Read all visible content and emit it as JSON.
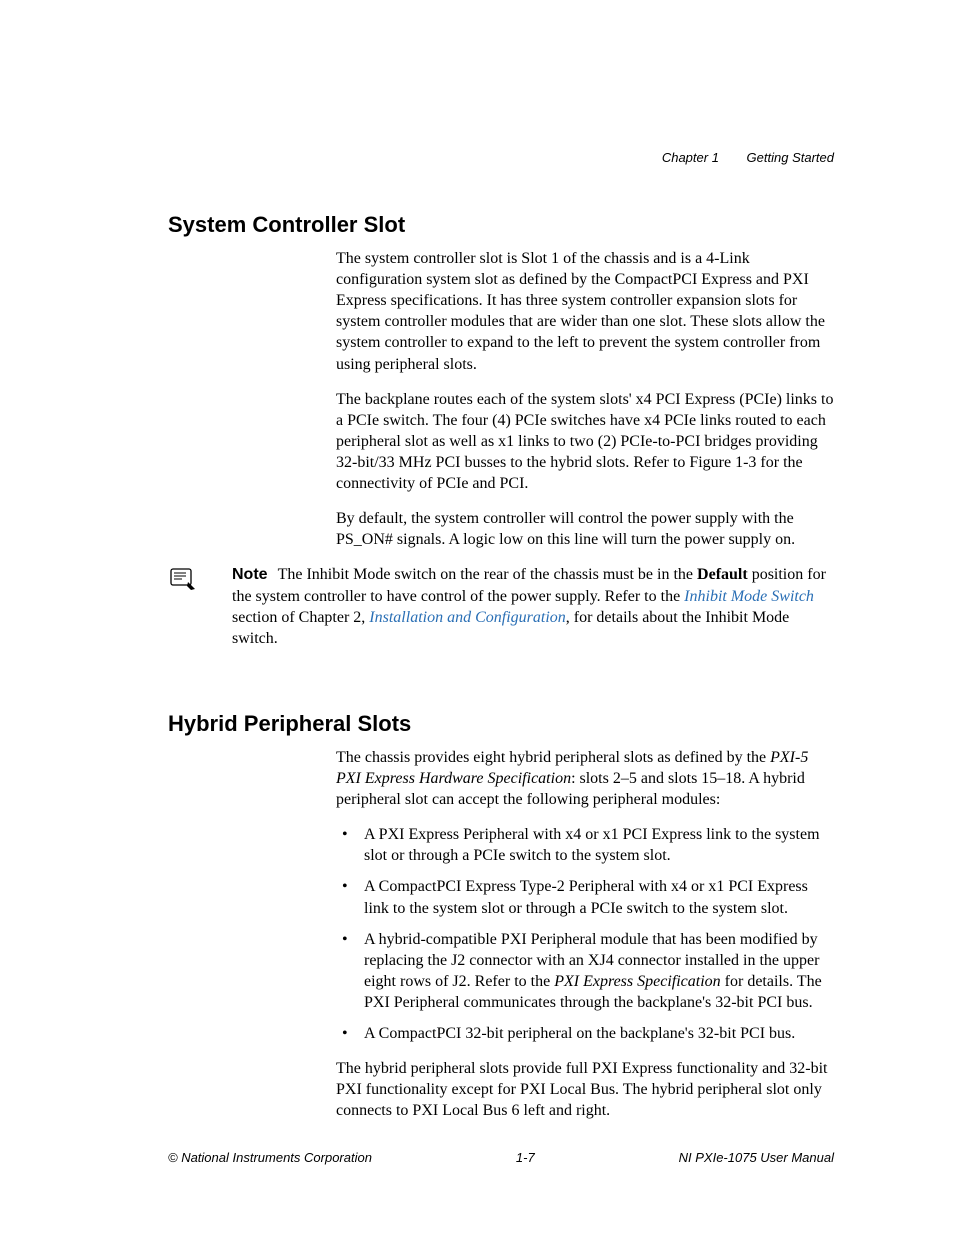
{
  "header": {
    "chapter": "Chapter 1",
    "title": "Getting Started"
  },
  "sections": {
    "system_controller": {
      "heading": "System Controller Slot",
      "p1": "The system controller slot is Slot 1 of the chassis and is a 4-Link configuration system slot as defined by the CompactPCI Express and PXI Express specifications. It has three system controller expansion slots for system controller modules that are wider than one slot. These slots allow the system controller to expand to the left to prevent the system controller from using peripheral slots.",
      "p2": "The backplane routes each of the system slots' x4 PCI Express (PCIe) links to a PCIe switch. The four (4) PCIe switches have x4 PCIe links routed to each peripheral slot as well as x1 links to two (2) PCIe-to-PCI bridges providing 32-bit/33 MHz PCI busses to the hybrid slots. Refer to Figure 1-3 for the connectivity of PCIe and PCI.",
      "p3": "By default, the system controller will control the power supply with the PS_ON# signals. A logic low on this line will turn the power supply on."
    },
    "note": {
      "label": "Note",
      "pre": "The Inhibit Mode switch on the rear of the chassis must be in the ",
      "bold1": "Default",
      "mid1": " position for the system controller to have control of the power supply. Refer to the ",
      "link1": "Inhibit Mode Switch",
      "mid2": " section of Chapter 2, ",
      "link2": "Installation and Configuration",
      "post": ", for details about the Inhibit Mode switch."
    },
    "hybrid": {
      "heading": "Hybrid Peripheral Slots",
      "intro_pre": "The chassis provides eight hybrid peripheral slots as defined by the ",
      "intro_ital": "PXI-5 PXI Express Hardware Specification",
      "intro_post": ": slots 2–5 and slots 15–18. A hybrid peripheral slot can accept the following peripheral modules:",
      "bullets": [
        "A PXI Express Peripheral with x4 or x1 PCI Express link to the system slot or through a PCIe switch to the system slot.",
        "A CompactPCI Express Type-2 Peripheral with x4 or x1 PCI Express link to the system slot or through a PCIe switch to the system slot."
      ],
      "bullet3_pre": "A hybrid-compatible PXI Peripheral module that has been modified by replacing the J2 connector with an XJ4 connector installed in the upper eight rows of J2. Refer to the ",
      "bullet3_ital": "PXI Express Specification",
      "bullet3_post": " for details. The PXI Peripheral communicates through the backplane's 32-bit PCI bus.",
      "bullet4": "A CompactPCI 32-bit peripheral on the backplane's 32-bit PCI bus.",
      "closing": "The hybrid peripheral slots provide full PXI Express functionality and 32-bit PXI functionality except for PXI Local Bus. The hybrid peripheral slot only connects to PXI Local Bus 6 left and right."
    }
  },
  "footer": {
    "left": "© National Instruments Corporation",
    "center": "1-7",
    "right": "NI PXIe-1075 User Manual"
  }
}
